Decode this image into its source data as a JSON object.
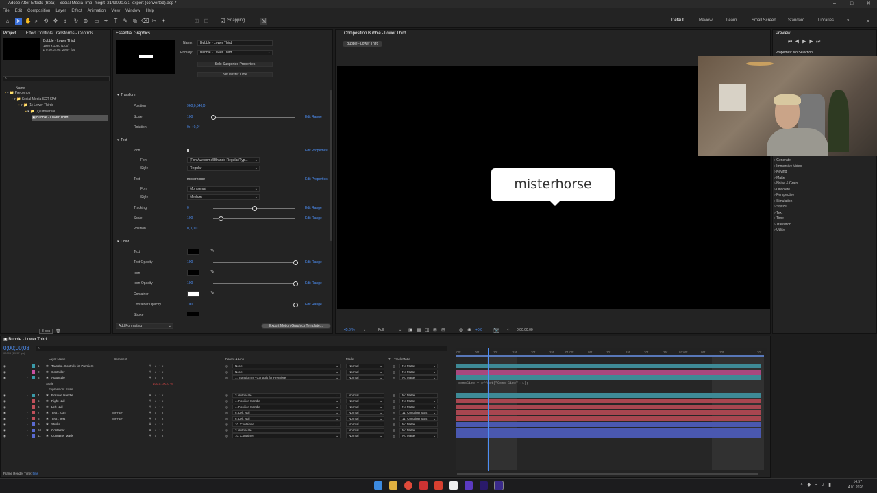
{
  "window": {
    "title": "Adobe After Effects (Beta) - Social Media_Imp_mogrt_2149090731_export (converted).aep *"
  },
  "menu": [
    "File",
    "Edit",
    "Composition",
    "Layer",
    "Effect",
    "Animation",
    "View",
    "Window",
    "Help"
  ],
  "toolbar": {
    "snapping": "Snapping",
    "workspaces": [
      "Default",
      "Review",
      "Learn",
      "Small Screen",
      "Standard",
      "Libraries"
    ]
  },
  "project": {
    "tab": "Project",
    "effect_tab": "Effect Controls Transforms - Controls",
    "item_name": "Bubble - Lower Third",
    "item_info": "1920 x 1080 (1,00)",
    "item_duration": "Δ 0;00;02;00, 29,97 fps",
    "col_name": "Name",
    "tree": [
      "Precomps",
      "Social Media SCT $Prf",
      "(1) Lower Thirds",
      "(1) Universal",
      "Bubble - Lower Third"
    ],
    "bpc": "8 bpc"
  },
  "eg": {
    "tab": "Essential Graphics",
    "name_label": "Name:",
    "name_value": "Bubble - Lower Third",
    "primary_label": "Primary:",
    "primary_value": "Bubble - Lower Third",
    "solo_btn": "Solo Supported Properties",
    "poster_btn": "Set Poster Time",
    "add_formatting": "Add Formatting",
    "export_btn": "Export Motion Graphics Template...",
    "sections": {
      "transform": "Transform",
      "text": "Text",
      "color": "Color"
    },
    "transform": {
      "position_label": "Position",
      "position_value": "960,0,540,0",
      "scale_label": "Scale",
      "scale_value": "100",
      "rotation_label": "Rotation",
      "rotation_value": "0x +0,0°"
    },
    "text": {
      "icon_label": "Icon",
      "icon_value": "",
      "font_label": "Font",
      "icon_font": "[FontAwesome5Brands-Regular/Typ...",
      "style_label": "Style",
      "icon_style": "Regular",
      "text_label": "Text",
      "text_value": "misterhorse",
      "text_font": "Montserrat",
      "text_style": "Medium",
      "tracking_label": "Tracking",
      "tracking_value": "0",
      "scale_label": "Scale",
      "scale_value": "100",
      "position_label": "Position",
      "position_value": "0,0,0,0"
    },
    "color": {
      "text_label": "Text",
      "text_opacity_label": "Text Opacity",
      "text_opacity": "100",
      "icon_label": "Icon",
      "icon_opacity_label": "Icon Opacity",
      "icon_opacity": "100",
      "container_label": "Container",
      "container_opacity_label": "Container Opacity",
      "container_opacity": "100",
      "stroke_label": "Stroke"
    },
    "edit_range": "Edit Range",
    "edit_properties": "Edit Properties"
  },
  "comp": {
    "tab": "Composition Bubble - Lower Third",
    "subtab": "Bubble - Lower Third",
    "bubble_text": "misterhorse",
    "zoom": "45,6 %",
    "resolution": "Full",
    "exposure": "+0,0",
    "timecode": "0;00;00;00"
  },
  "preview": {
    "tab": "Preview",
    "props": "Properties: No Selection"
  },
  "effects_list": [
    "Generate",
    "Immersive Video",
    "Keying",
    "Matte",
    "Noise & Grain",
    "Obsolete",
    "Perspective",
    "Simulation",
    "Stylize",
    "Text",
    "Time",
    "Transition",
    "Utility"
  ],
  "timeline": {
    "tab": "Bubble - Lower Third",
    "timecode": "0;00;00;08",
    "fps_info": "00008 (29.97 fps)",
    "cols": {
      "layer": "Layer Name",
      "comment": "Comment",
      "parent": "Parent & Link",
      "mode": "Mode",
      "t": "T",
      "matte": "Track Matte"
    },
    "ruler": [
      ":00f",
      "05f",
      "10f",
      "15f",
      "20f",
      "25f",
      "01:00f",
      "05f",
      "10f",
      "15f",
      "20f",
      "25f",
      "02:00f",
      "05f",
      "10f",
      "20f"
    ],
    "layers": [
      {
        "num": "1",
        "name": "Transfo...Controls for Premiere",
        "comment": "",
        "parent": "None",
        "mode": "Normal",
        "matte": "No Matte",
        "color": "#3a9aa8",
        "bar": "#3e8a96"
      },
      {
        "num": "2",
        "name": "Controller",
        "comment": "",
        "parent": "None",
        "mode": "Normal",
        "matte": "No Matte",
        "color": "#c850a0",
        "bar": "#a8487e"
      },
      {
        "num": "3",
        "name": "Autoscale",
        "comment": "",
        "parent": "1. Transforms - Controls for Premiere",
        "mode": "Normal",
        "matte": "No Matte",
        "color": "#3a9aa8",
        "bar": "#3e8a96"
      },
      {
        "num": "",
        "name": "Scale",
        "comment": "",
        "parent": "",
        "mode": "",
        "matte": "",
        "color": "",
        "bar": ""
      },
      {
        "num": "",
        "name": "Expression: Scale",
        "comment": "",
        "parent": "",
        "mode": "",
        "matte": "",
        "color": "",
        "bar": ""
      },
      {
        "num": "4",
        "name": "Position Handle",
        "comment": "",
        "parent": "3. Autoscale",
        "mode": "Normal",
        "matte": "No Matte",
        "color": "#3a9aa8",
        "bar": "#3e8a96"
      },
      {
        "num": "5",
        "name": "Right Null",
        "comment": "",
        "parent": "4. Position Handle",
        "mode": "Normal",
        "matte": "No Matte",
        "color": "#c0505a",
        "bar": "#a84650"
      },
      {
        "num": "6",
        "name": "Left Null",
        "comment": "",
        "parent": "4. Position Handle",
        "mode": "Normal",
        "matte": "No Matte",
        "color": "#c0505a",
        "bar": "#a84650"
      },
      {
        "num": "7",
        "name": "Text : Icon",
        "comment": "MPFEF",
        "parent": "6. Left Null",
        "mode": "Normal",
        "matte": "11. Container Mas",
        "color": "#c0505a",
        "bar": "#a84650"
      },
      {
        "num": "8",
        "name": "Text : Text",
        "comment": "MPFEF",
        "parent": "6. Left Null",
        "mode": "Normal",
        "matte": "11. Container Mas",
        "color": "#c0505a",
        "bar": "#a84650"
      },
      {
        "num": "9",
        "name": "Stroke",
        "comment": "",
        "parent": "10. Container",
        "mode": "Normal",
        "matte": "No Matte",
        "color": "#5a6ad0",
        "bar": "#4a58b0"
      },
      {
        "num": "10",
        "name": "Container",
        "comment": "",
        "parent": "3. Autoscale",
        "mode": "Normal",
        "matte": "No Matte",
        "color": "#5a6ad0",
        "bar": "#4a58b0"
      },
      {
        "num": "11",
        "name": "Container Mask",
        "comment": "",
        "parent": "10. Container",
        "mode": "Normal",
        "matte": "No Matte",
        "color": "#5a6ad0",
        "bar": "#4a58b0"
      }
    ],
    "scale_value": "100,0,100,0 %",
    "expression": "compSize = effect(\"Comp Size\")(1);",
    "render_time_label": "Frame Render Time:",
    "render_time": "5ms"
  },
  "taskbar": {
    "time": "14:57",
    "date": "4.01.2026"
  }
}
